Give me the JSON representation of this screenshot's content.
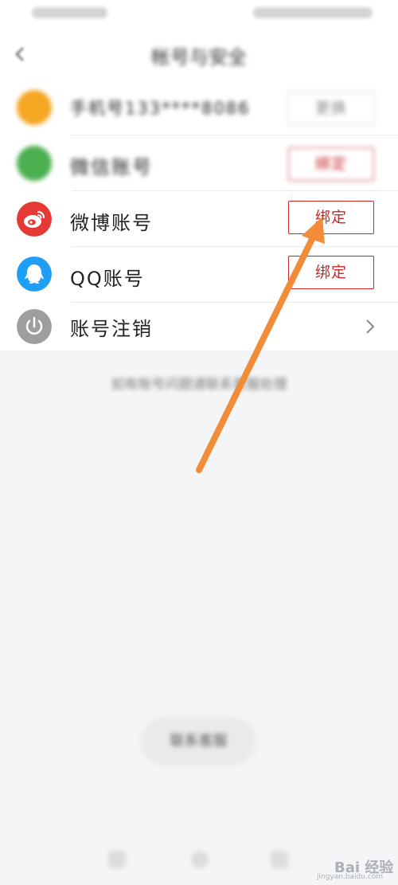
{
  "header": {
    "title": "帐号与安全",
    "back_icon": "chevron-left-icon"
  },
  "accounts": {
    "phone": {
      "label": "手机号133****8086",
      "button": "更换",
      "icon": "phone-avatar-icon",
      "color": "#f5a623"
    },
    "wechat": {
      "label": "微信账号",
      "button": "绑定",
      "icon": "wechat-icon",
      "color": "#4caf50"
    },
    "weibo": {
      "label": "微博账号",
      "button": "绑定",
      "icon": "weibo-icon",
      "color": "#e53935"
    },
    "qq": {
      "label": "QQ账号",
      "button": "绑定",
      "icon": "qq-icon",
      "color": "#1e9ef5"
    },
    "cancel": {
      "label": "账号注销",
      "icon": "power-icon",
      "color": "#9e9e9e"
    }
  },
  "tip": "如有账号问题请联系客服处理",
  "bottom_button": "联系客服",
  "watermark": {
    "text": "Bai 经验",
    "url": "jingyan.baidu.com"
  },
  "colors": {
    "accent": "#c62828",
    "annotation_arrow": "#f28c38"
  }
}
